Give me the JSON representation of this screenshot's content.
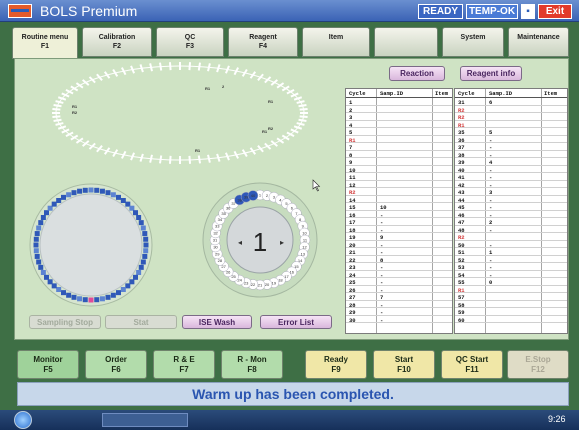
{
  "app": {
    "title": "BOLS Premium",
    "status_ready": "READY",
    "status_temp": "TEMP-OK",
    "exit_label": "Exit"
  },
  "tabs": [
    {
      "l1": "Routine menu",
      "l2": "F1"
    },
    {
      "l1": "Calibration",
      "l2": "F2"
    },
    {
      "l1": "QC",
      "l2": "F3"
    },
    {
      "l1": "Reagent",
      "l2": "F4"
    },
    {
      "l1": "Item",
      "l2": ""
    },
    {
      "l1": "",
      "l2": ""
    },
    {
      "l1": "System",
      "l2": ""
    },
    {
      "l1": "Maintenance",
      "l2": ""
    }
  ],
  "view_buttons": {
    "reaction": "Reaction",
    "reagent_info": "Reagent info"
  },
  "reaction_labels": [
    "R1",
    "2",
    "R1",
    "R1",
    "R2",
    "R1",
    "R2",
    "R1"
  ],
  "carousel": {
    "position": "1",
    "nums": [
      "1",
      "2",
      "3",
      "4",
      "5",
      "6",
      "7",
      "8",
      "9",
      "10",
      "11",
      "12",
      "13",
      "14",
      "15",
      "16",
      "17",
      "18",
      "19",
      "20",
      "21",
      "22",
      "23",
      "24",
      "25",
      "26",
      "27",
      "28",
      "29",
      "30",
      "31",
      "32",
      "33",
      "34",
      "35",
      "36",
      "37",
      "38",
      "39",
      "40"
    ]
  },
  "action_buttons": {
    "sampling_stop": "Sampling Stop",
    "stat": "Stat",
    "ise_wash": "ISE Wash",
    "error_list": "Error List"
  },
  "table": {
    "headers": [
      "Cycle",
      "Samp.ID",
      "Item"
    ],
    "left": [
      [
        "1",
        "",
        ""
      ],
      [
        "2",
        "",
        ""
      ],
      [
        "3",
        "",
        ""
      ],
      [
        "4",
        "",
        ""
      ],
      [
        "5",
        "",
        ""
      ],
      [
        "R1",
        "",
        ""
      ],
      [
        "7",
        "",
        ""
      ],
      [
        "8",
        "",
        ""
      ],
      [
        "9",
        "",
        ""
      ],
      [
        "10",
        "",
        ""
      ],
      [
        "11",
        "",
        ""
      ],
      [
        "12",
        "",
        ""
      ],
      [
        "R2",
        "",
        ""
      ],
      [
        "14",
        "",
        ""
      ],
      [
        "15",
        "10",
        ""
      ],
      [
        "16",
        "-",
        ""
      ],
      [
        "17",
        "-",
        ""
      ],
      [
        "18",
        "-",
        ""
      ],
      [
        "19",
        "9",
        ""
      ],
      [
        "20",
        "-",
        ""
      ],
      [
        "21",
        "-",
        ""
      ],
      [
        "22",
        "8",
        ""
      ],
      [
        "23",
        "-",
        ""
      ],
      [
        "24",
        "-",
        ""
      ],
      [
        "25",
        "-",
        ""
      ],
      [
        "26",
        "-",
        ""
      ],
      [
        "27",
        "7",
        ""
      ],
      [
        "28",
        "-",
        ""
      ],
      [
        "29",
        "-",
        ""
      ],
      [
        "30",
        "-",
        ""
      ]
    ],
    "right": [
      [
        "31",
        "6",
        ""
      ],
      [
        "R2",
        "",
        ""
      ],
      [
        "R2",
        "",
        ""
      ],
      [
        "R1",
        "",
        ""
      ],
      [
        "35",
        "5",
        ""
      ],
      [
        "36",
        "-",
        ""
      ],
      [
        "37",
        "-",
        ""
      ],
      [
        "38",
        "-",
        ""
      ],
      [
        "39",
        "4",
        ""
      ],
      [
        "40",
        "-",
        ""
      ],
      [
        "41",
        "-",
        ""
      ],
      [
        "42",
        "-",
        ""
      ],
      [
        "43",
        "3",
        ""
      ],
      [
        "44",
        "-",
        ""
      ],
      [
        "45",
        "-",
        ""
      ],
      [
        "46",
        "-",
        ""
      ],
      [
        "47",
        "2",
        ""
      ],
      [
        "48",
        "-",
        ""
      ],
      [
        "R2",
        "",
        ""
      ],
      [
        "50",
        "-",
        ""
      ],
      [
        "51",
        "1",
        ""
      ],
      [
        "52",
        "-",
        ""
      ],
      [
        "53",
        "-",
        ""
      ],
      [
        "54",
        "-",
        ""
      ],
      [
        "55",
        "0",
        ""
      ],
      [
        "R1",
        "",
        ""
      ],
      [
        "57",
        "",
        ""
      ],
      [
        "58",
        "",
        ""
      ],
      [
        "59",
        "",
        ""
      ],
      [
        "60",
        "",
        ""
      ]
    ]
  },
  "fkeys": [
    {
      "l1": "Monitor",
      "l2": "F5"
    },
    {
      "l1": "Order",
      "l2": "F6"
    },
    {
      "l1": "R & E",
      "l2": "F7"
    },
    {
      "l1": "R - Mon",
      "l2": "F8"
    },
    {
      "l1": "Ready",
      "l2": "F9"
    },
    {
      "l1": "Start",
      "l2": "F10"
    },
    {
      "l1": "QC Start",
      "l2": "F11"
    },
    {
      "l1": "E.Stop",
      "l2": "F12"
    }
  ],
  "message": "Warm up has been completed.",
  "clock": "9:26",
  "colors": {
    "panel": "#cfe3c4",
    "reagent_blue": "#2f58b8",
    "message": "#2a55b0",
    "red_label": "#d23c3c"
  }
}
